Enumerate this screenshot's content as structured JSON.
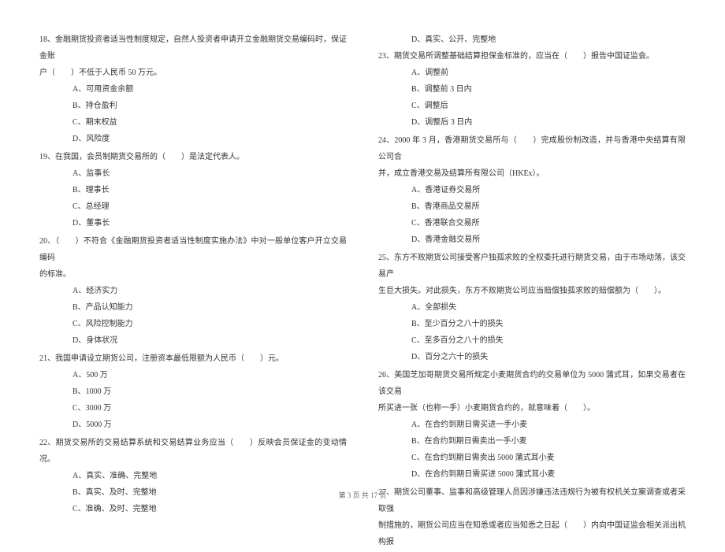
{
  "left": {
    "q18": {
      "text": "18、金融期货投资者适当性制度规定，自然人投资者申请开立金融期货交易编码时，保证金账",
      "cont": "户（　　）不低于人民币 50 万元。",
      "a": "A、可用资金余额",
      "b": "B、持仓盈利",
      "c": "C、期末权益",
      "d": "D、风险度"
    },
    "q19": {
      "text": "19、在我国，会员制期货交易所的（　　）是法定代表人。",
      "a": "A、监事长",
      "b": "B、理事长",
      "c": "C、总经理",
      "d": "D、董事长"
    },
    "q20": {
      "text": "20、（　　）不符合《金融期货投资者适当性制度实施办法》中对一般单位客户开立交易编码",
      "cont": "的标准。",
      "a": "A、经济实力",
      "b": "B、产品认知能力",
      "c": "C、风险控制能力",
      "d": "D、身体状况"
    },
    "q21": {
      "text": "21、我国申请设立期货公司，注册资本最低限额为人民币（　　）元。",
      "a": "A、500 万",
      "b": "B、1000 万",
      "c": "C、3000 万",
      "d": "D、5000 万"
    },
    "q22": {
      "text": "22、期货交易所的交易结算系统和交易结算业务应当（　　）反映会员保证金的变动情况。",
      "a": "A、真实、准确、完整地",
      "b": "B、真实、及时、完整地",
      "c": "C、准确、及时、完整地"
    }
  },
  "right": {
    "q22d": "D、真实、公开、完整地",
    "q23": {
      "text": "23、期货交易所调整基础结算担保金标准的，应当在（　　）报告中国证监会。",
      "a": "A、调整前",
      "b": "B、调整前 3 日内",
      "c": "C、调整后",
      "d": "D、调整后 3 日内"
    },
    "q24": {
      "text": "24、2000 年 3 月，香港期货交易所与（　　）完成股份制改造，并与香港中央结算有限公司合",
      "cont": "并，成立香港交易及结算所有限公司（HKEx）。",
      "a": "A、香港证券交易所",
      "b": "B、香港商品交易所",
      "c": "C、香港联合交易所",
      "d": "D、香港金融交易所"
    },
    "q25": {
      "text": "25、东方不败期货公司接受客户独孤求败的全权委托进行期货交易，由于市场动荡，该交易产",
      "cont": "生巨大损失。对此损失，东方不败期货公司应当赔偿独孤求败的赔偿额为（　　）。",
      "a": "A、全部损失",
      "b": "B、至少百分之八十的损失",
      "c": "C、至多百分之八十的损失",
      "d": "D、百分之六十的损失"
    },
    "q26": {
      "text": "26、美国芝加哥期货交易所规定小麦期货合约的交易单位为 5000 蒲式耳，如果交易者在该交易",
      "cont": "所买进一张（也称一手）小麦期货合约的，就意味着（　　）。",
      "a": "A、在合约到期日需买进一手小麦",
      "b": "B、在合约到期日需卖出一手小麦",
      "c": "C、在合约到期日需卖出 5000 蒲式耳小麦",
      "d": "D、在合约到期日需买进 5000 蒲式耳小麦"
    },
    "q27": {
      "text": "27、期货公司董事、监事和高级管理人员因涉嫌违法违规行为被有权机关立案调查或者采取强",
      "cont": "制措施的，期货公司应当在知悉或者应当知悉之日起（　　）内向中国证监会相关派出机构报"
    }
  },
  "footer": "第 3 页 共 17 页"
}
